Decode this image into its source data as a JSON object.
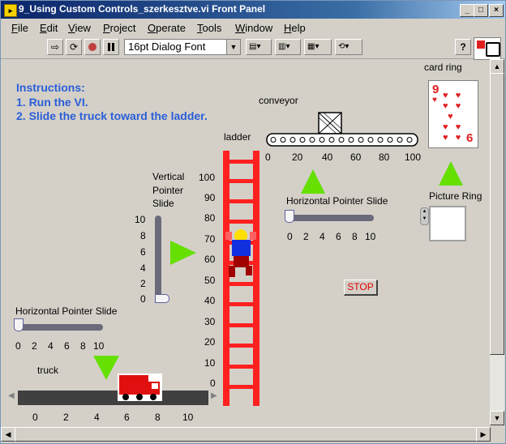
{
  "window": {
    "title": "9_Using Custom Controls_szerkesztve.vi Front Panel",
    "min_btn": "_",
    "max_btn": "□",
    "close_btn": "×"
  },
  "menu": [
    {
      "label": "File",
      "u": "F",
      "rest": "ile"
    },
    {
      "label": "Edit",
      "u": "E",
      "rest": "dit"
    },
    {
      "label": "View",
      "u": "V",
      "rest": "iew"
    },
    {
      "label": "Project",
      "u": "P",
      "rest": "roject"
    },
    {
      "label": "Operate",
      "u": "O",
      "rest": "perate"
    },
    {
      "label": "Tools",
      "u": "T",
      "rest": "ools"
    },
    {
      "label": "Window",
      "u": "W",
      "rest": "indow"
    },
    {
      "label": "Help",
      "u": "H",
      "rest": "elp"
    }
  ],
  "toolbar": {
    "font": "16pt Dialog Font",
    "help": "?"
  },
  "instructions": {
    "heading": "Instructions:",
    "step1": "1. Run the VI.",
    "step2": "2. Slide the truck toward the ladder."
  },
  "controls": {
    "conveyor_label": "conveyor",
    "conveyor_ticks": [
      "0",
      "20",
      "40",
      "60",
      "80",
      "100"
    ],
    "conveyor_value": 40,
    "ladder_label": "ladder",
    "ladder_ticks": [
      "100",
      "90",
      "80",
      "70",
      "60",
      "50",
      "40",
      "30",
      "20",
      "10",
      "0"
    ],
    "ladder_value": 60,
    "vslide_label_1": "Vertical",
    "vslide_label_2": "Pointer",
    "vslide_label_3": "Slide",
    "vslide_ticks": [
      "10",
      "8",
      "6",
      "4",
      "2",
      "0"
    ],
    "vslide_value": 0,
    "hslide_left_label": "Horizontal Pointer Slide",
    "hslide_left_ticks": [
      "0",
      "2",
      "4",
      "6",
      "8",
      "10"
    ],
    "hslide_left_value": 0,
    "hslide_right_label": "Horizontal Pointer Slide",
    "hslide_right_ticks": [
      "0",
      "2",
      "4",
      "6",
      "8",
      "10"
    ],
    "hslide_right_value": 0,
    "truck_label": "truck",
    "truck_ticks": [
      "0",
      "2",
      "4",
      "6",
      "8",
      "10"
    ],
    "truck_value": 6.5,
    "card_ring_label": "card ring",
    "card_rank": "9",
    "card_rank_bottom": "6",
    "picture_ring_label": "Picture Ring",
    "stop_label": "STOP"
  },
  "colors": {
    "instructions": "#2a5ed8",
    "ladder": "#ff2020",
    "arrow_green": "#66e000",
    "truck_red": "#e01010",
    "stop_text": "#e00000",
    "card_red": "#e02020"
  }
}
